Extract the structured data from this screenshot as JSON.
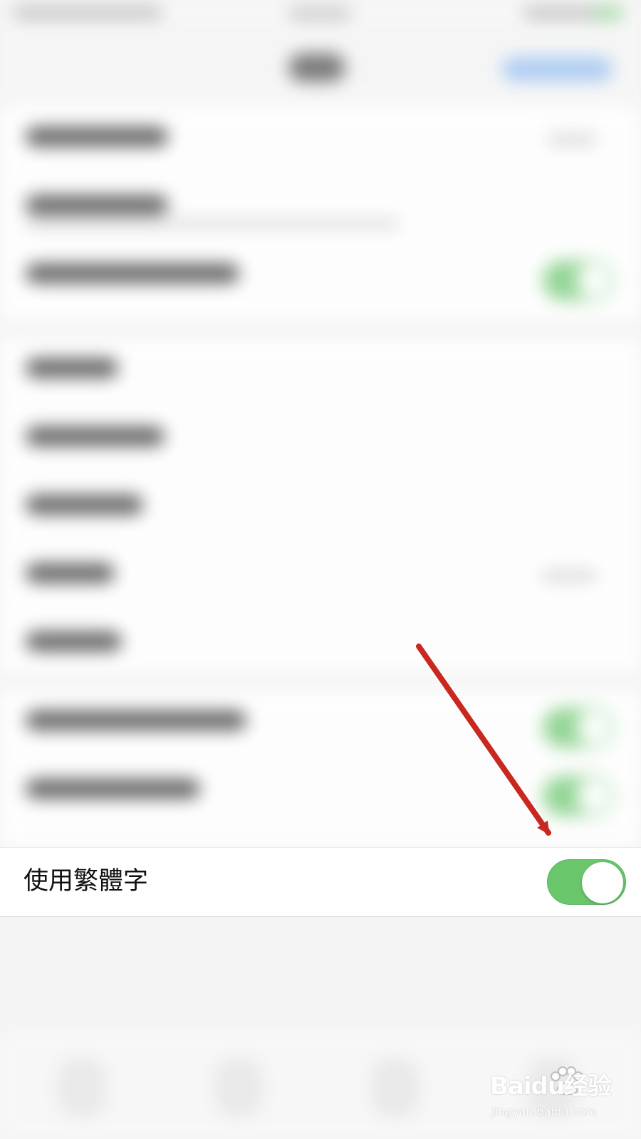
{
  "settings": {
    "focused_row": {
      "label": "使用繁體字",
      "toggle_state": "on"
    }
  },
  "watermark": {
    "logo_text": "Baidu经验",
    "url": "jingyan.baidu.com"
  },
  "colors": {
    "toggle_on": "#69c66b",
    "annotation_arrow": "#c8281f",
    "accent_blur_blue": "#86b6f5"
  },
  "icons": {
    "toggle": "toggle-switch",
    "annotation": "arrow-icon",
    "watermark": "paw-icon"
  }
}
